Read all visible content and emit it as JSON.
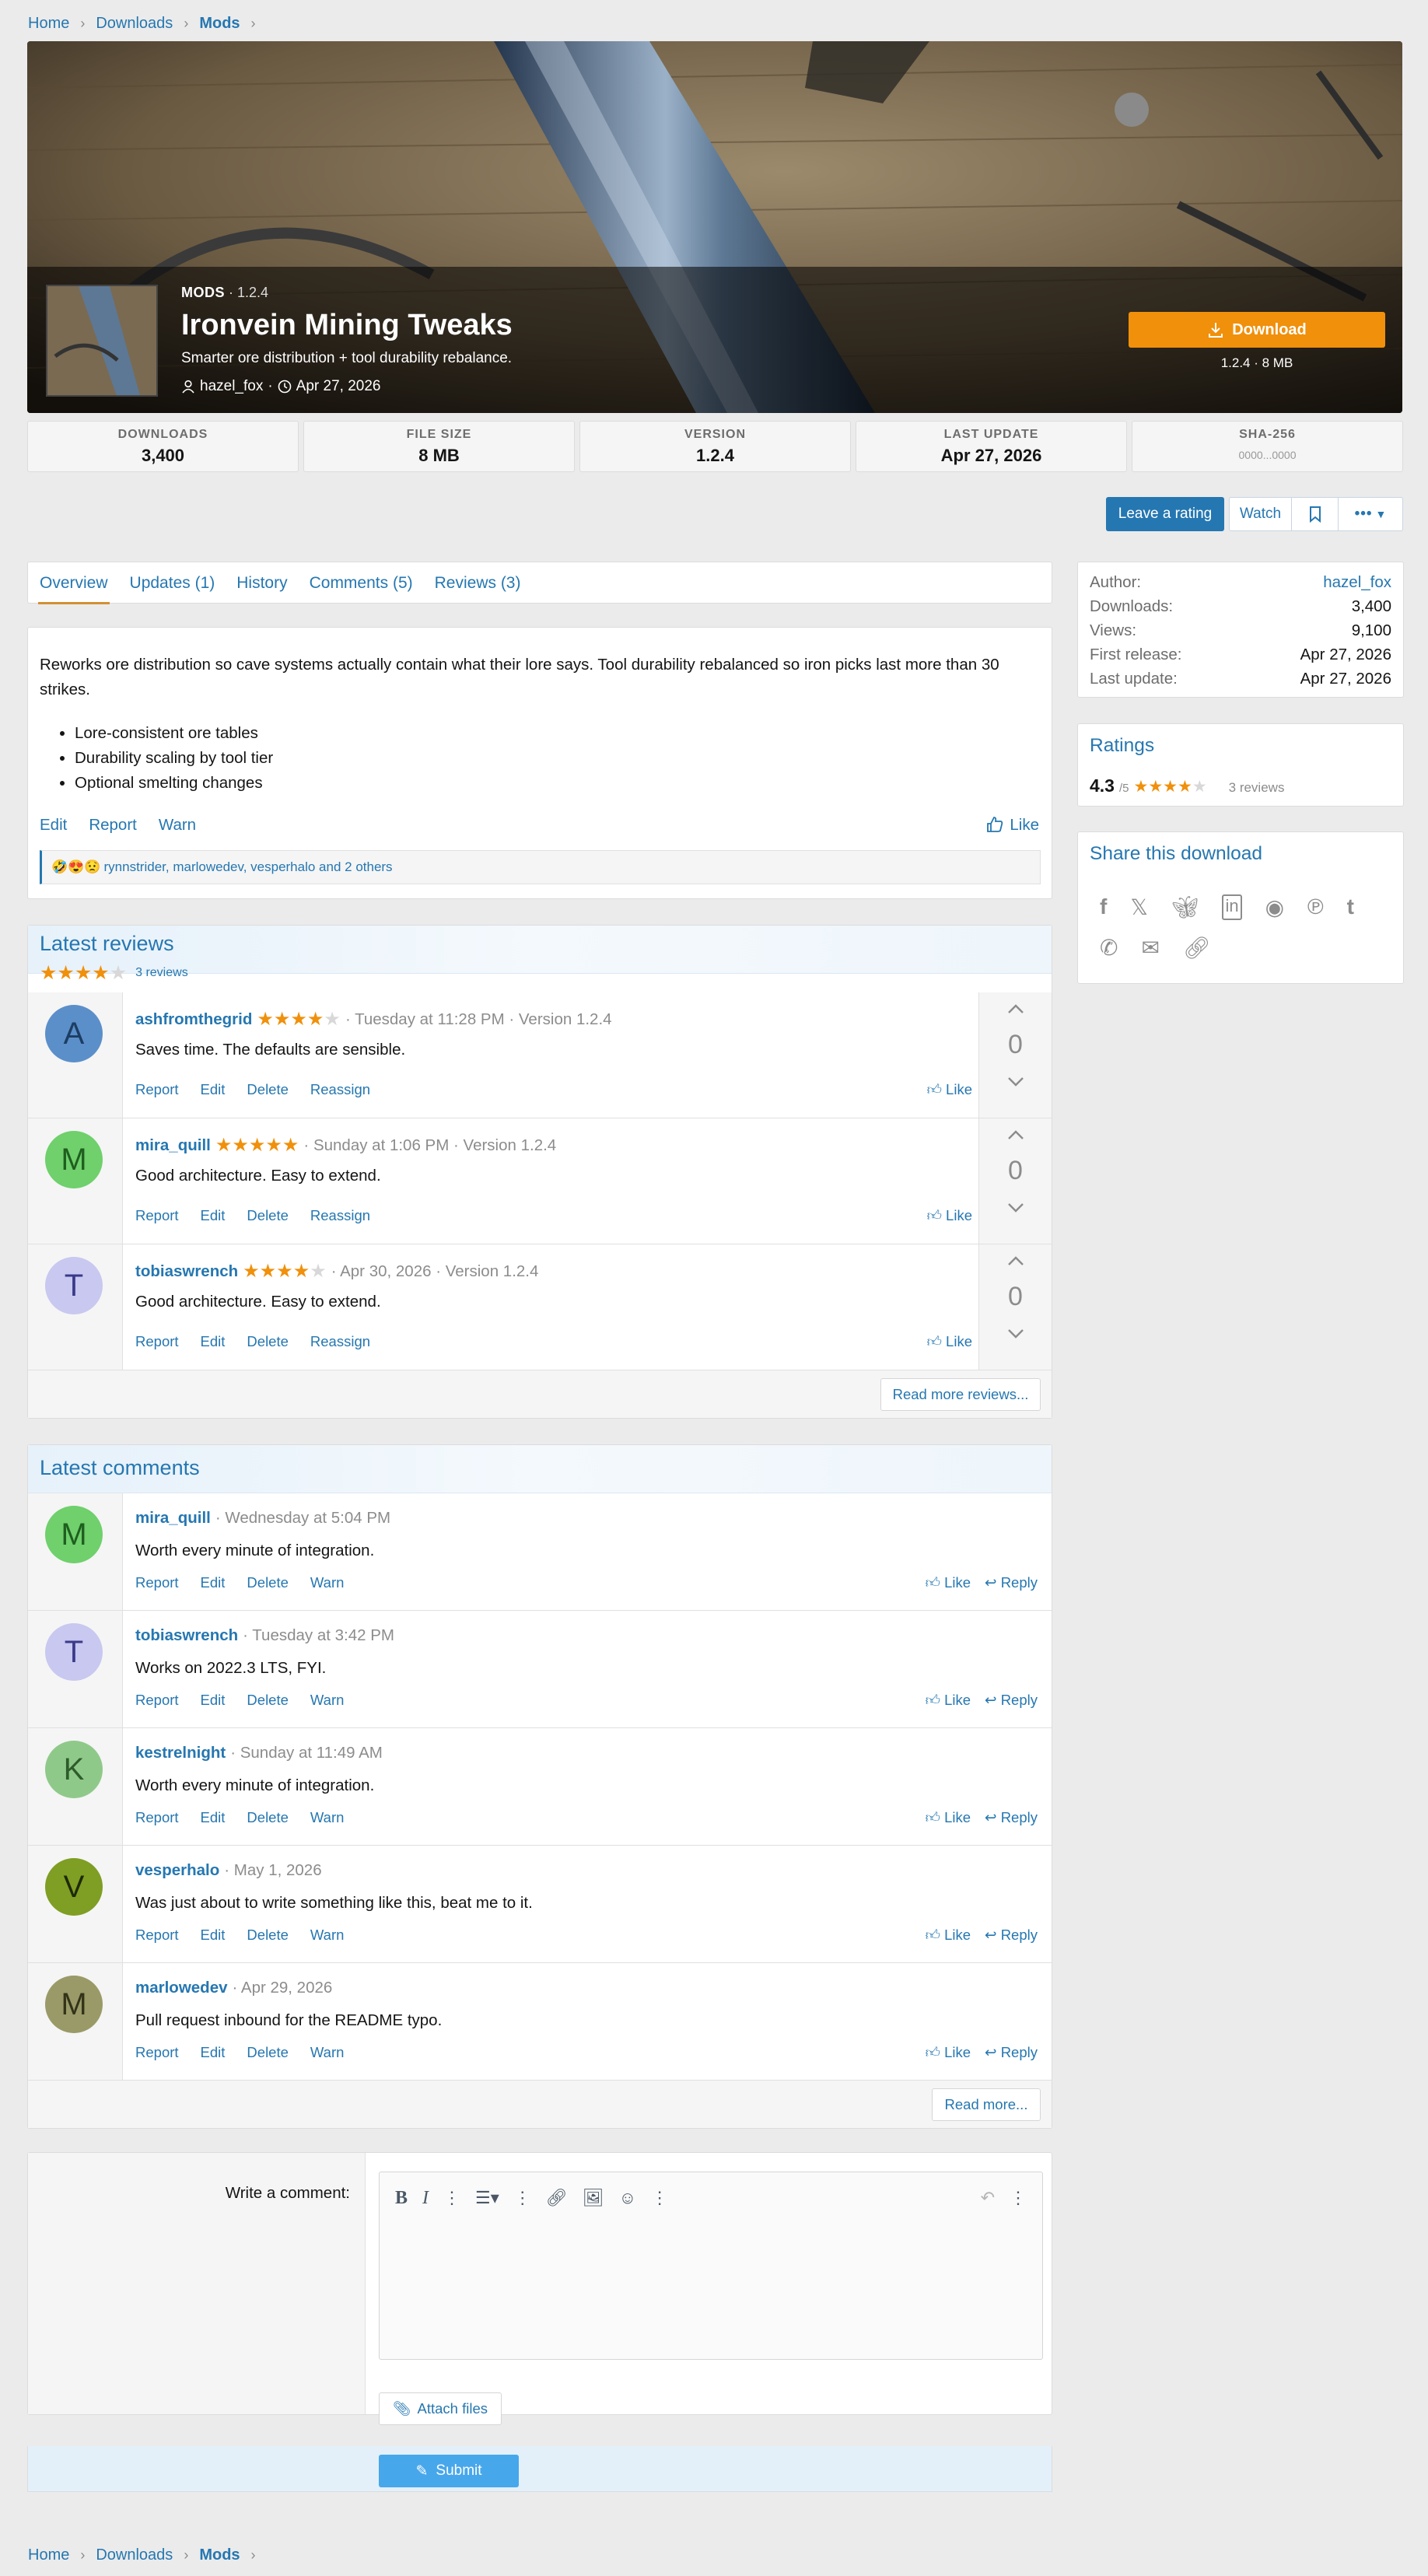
{
  "breadcrumb": {
    "home": "Home",
    "downloads": "Downloads",
    "mods": "Mods"
  },
  "hero": {
    "category": "MODS",
    "version": "1.2.4",
    "title": "Ironvein Mining Tweaks",
    "tagline": "Smarter ore distribution + tool durability rebalance.",
    "author": "hazel_fox",
    "date": "Apr 27, 2026",
    "download_label": "Download",
    "download_sub": "1.2.4 · 8 MB"
  },
  "stats": [
    {
      "label": "DOWNLOADS",
      "value": "3,400"
    },
    {
      "label": "FILE SIZE",
      "value": "8 MB"
    },
    {
      "label": "VERSION",
      "value": "1.2.4"
    },
    {
      "label": "LAST UPDATE",
      "value": "Apr 27, 2026"
    },
    {
      "label": "SHA-256",
      "value": "0000...0000"
    }
  ],
  "actions": {
    "rate": "Leave a rating",
    "watch": "Watch"
  },
  "tabs": [
    "Overview",
    "Updates (1)",
    "History",
    "Comments (5)",
    "Reviews (3)"
  ],
  "overview": {
    "text": "Reworks ore distribution so cave systems actually contain what their lore says. Tool durability rebalanced so iron picks last more than 30 strikes.",
    "bullets": [
      "Lore-consistent ore tables",
      "Durability scaling by tool tier",
      "Optional smelting changes"
    ],
    "links": [
      "Edit",
      "Report",
      "Warn"
    ],
    "like": "Like",
    "reactions_emoji": "🤣😍😟",
    "reactions_text": "rynnstrider, marlowedev, vesperhalo and 2 others"
  },
  "reviews": {
    "title": "Latest reviews",
    "count": "3 reviews",
    "rating_value": 4.3,
    "items": [
      {
        "initial": "A",
        "user": "ashfromthegrid",
        "rating": 4,
        "meta": "· Tuesday at 11:28 PM · Version 1.2.4",
        "text": "Saves time. The defaults are sensible.",
        "votes": "0",
        "avatar_bg": "#5b8fc9",
        "avatar_fg": "#1c3d63"
      },
      {
        "initial": "M",
        "user": "mira_quill",
        "rating": 5,
        "meta": "· Sunday at 1:06 PM · Version 1.2.4",
        "text": "Good architecture. Easy to extend.",
        "votes": "0",
        "avatar_bg": "#6fd06c",
        "avatar_fg": "#1f5e1e"
      },
      {
        "initial": "T",
        "user": "tobiaswrench",
        "rating": 4,
        "meta": "· Apr 30, 2026 · Version 1.2.4",
        "text": "Good architecture. Easy to extend.",
        "votes": "0",
        "avatar_bg": "#c8c8f0",
        "avatar_fg": "#3a3a8a"
      }
    ],
    "acts": [
      "Report",
      "Edit",
      "Delete",
      "Reassign"
    ],
    "like": "Like",
    "more": "Read more reviews..."
  },
  "comments": {
    "title": "Latest comments",
    "items": [
      {
        "initial": "M",
        "user": "mira_quill",
        "meta": "· Wednesday at 5:04 PM",
        "text": "Worth every minute of integration.",
        "avatar_bg": "#6fd06c",
        "avatar_fg": "#1f5e1e"
      },
      {
        "initial": "T",
        "user": "tobiaswrench",
        "meta": "· Tuesday at 3:42 PM",
        "text": "Works on 2022.3 LTS, FYI.",
        "avatar_bg": "#c8c8f0",
        "avatar_fg": "#3a3a8a"
      },
      {
        "initial": "K",
        "user": "kestrelnight",
        "meta": "· Sunday at 11:49 AM",
        "text": "Worth every minute of integration.",
        "avatar_bg": "#8fc98a",
        "avatar_fg": "#2e5c2a"
      },
      {
        "initial": "V",
        "user": "vesperhalo",
        "meta": "· May 1, 2026",
        "text": "Was just about to write something like this, beat me to it.",
        "avatar_bg": "#7f9e24",
        "avatar_fg": "#1d2a04"
      },
      {
        "initial": "M",
        "user": "marlowedev",
        "meta": "· Apr 29, 2026",
        "text": "Pull request inbound for the README typo.",
        "avatar_bg": "#9a9a68",
        "avatar_fg": "#33331a"
      }
    ],
    "acts": [
      "Report",
      "Edit",
      "Delete",
      "Warn"
    ],
    "like": "Like",
    "reply": "Reply",
    "more": "Read more..."
  },
  "editor": {
    "label": "Write a comment:",
    "attach": "Attach files",
    "submit": "Submit"
  },
  "sidebar": {
    "info": [
      {
        "k": "Author:",
        "v": "hazel_fox"
      },
      {
        "k": "Downloads:",
        "v": "3,400"
      },
      {
        "k": "Views:",
        "v": "9,100"
      },
      {
        "k": "First release:",
        "v": "Apr 27, 2026"
      },
      {
        "k": "Last update:",
        "v": "Apr 27, 2026"
      }
    ],
    "ratings_title": "Ratings",
    "rating_value": "4.3",
    "rating_scale": "/5",
    "rating_count": "3 reviews",
    "share_title": "Share this download"
  },
  "colors": {
    "accent": "#2577b1",
    "download": "#f0900b",
    "star": "#f0900b",
    "tab_underline": "#d48f33"
  }
}
